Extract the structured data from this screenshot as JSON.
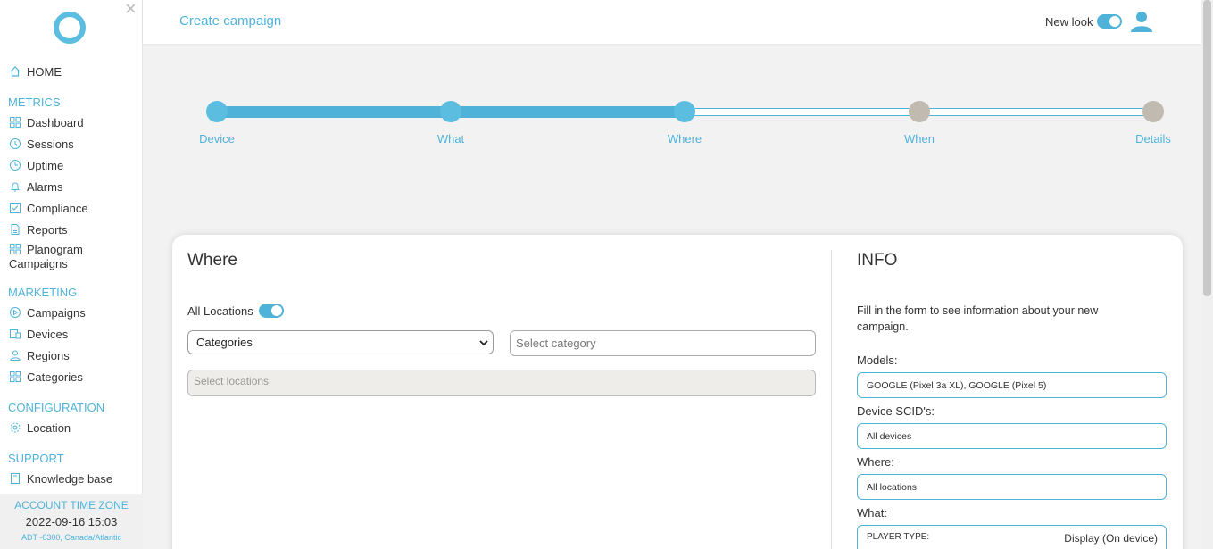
{
  "sidebar": {
    "home": "HOME",
    "sections": {
      "metrics": "METRICS",
      "marketing": "MARKETING",
      "configuration": "CONFIGURATION",
      "support": "SUPPORT"
    },
    "metrics_items": [
      "Dashboard",
      "Sessions",
      "Uptime",
      "Alarms",
      "Compliance",
      "Reports"
    ],
    "planogram": {
      "line1": "Planogram",
      "line2": "Campaigns"
    },
    "marketing_items": [
      "Campaigns",
      "Devices",
      "Regions",
      "Categories"
    ],
    "configuration_items": [
      "Location"
    ],
    "support_items": [
      "Knowledge base"
    ],
    "timezone": {
      "title": "ACCOUNT TIME ZONE",
      "time": "2022-09-16 15:03",
      "zone": "ADT -0300, Canada/Atlantic"
    }
  },
  "header": {
    "title": "Create campaign",
    "new_look_label": "New look",
    "new_look_on": true
  },
  "stepper": {
    "steps": [
      "Device",
      "What",
      "Where",
      "When",
      "Details"
    ],
    "current_step": "Where"
  },
  "where": {
    "heading": "Where",
    "all_locations_label": "All Locations",
    "all_locations_on": true,
    "filter_select": "Categories",
    "category_placeholder": "Select category",
    "locations_placeholder": "Select locations"
  },
  "info": {
    "heading": "INFO",
    "description": "Fill in the form to see information about your new campaign.",
    "models_label": "Models:",
    "models_value": "GOOGLE (Pixel 3a XL), GOOGLE (Pixel 5)",
    "scid_label": "Device SCID's:",
    "scid_value": "All devices",
    "where_label": "Where:",
    "where_value": "All locations",
    "what_label": "What:",
    "player_type_key": "PLAYER TYPE:",
    "player_type_value": "Display (On device)"
  },
  "colors": {
    "accent": "#4fb3d9",
    "dot_active": "#5bbde0",
    "dot_future": "#c0bab0"
  }
}
